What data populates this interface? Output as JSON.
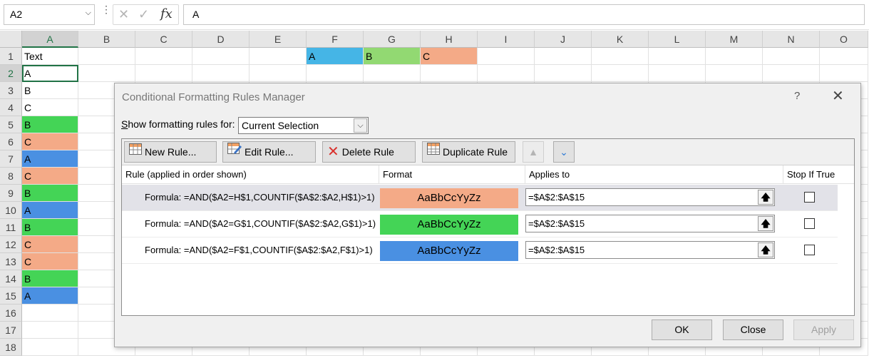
{
  "formula_bar": {
    "name_box": "A2",
    "formula": "A",
    "cancel_icon": "cancel-x-icon",
    "enter_icon": "checkmark-icon",
    "fx_label": "fx"
  },
  "sheet": {
    "columns": [
      "A",
      "B",
      "C",
      "D",
      "E",
      "F",
      "G",
      "H",
      "I",
      "J",
      "K",
      "L",
      "M",
      "N",
      "O"
    ],
    "rows": [
      "1",
      "2",
      "3",
      "4",
      "5",
      "6",
      "7",
      "8",
      "9",
      "10",
      "11",
      "12",
      "13",
      "14",
      "15",
      "16",
      "17",
      "18"
    ],
    "column_a": [
      "Text",
      "A",
      "B",
      "C",
      "B",
      "C",
      "A",
      "C",
      "B",
      "A",
      "B",
      "C",
      "C",
      "B",
      "A",
      "",
      "",
      ""
    ],
    "column_a_fill": [
      "none",
      "none",
      "none",
      "none",
      "green",
      "salmon",
      "blue",
      "salmon",
      "green",
      "blue",
      "green",
      "salmon",
      "salmon",
      "green",
      "blue",
      "none",
      "none",
      "none"
    ],
    "header_cells": {
      "F1": "A",
      "G1": "B",
      "H1": "C"
    },
    "colors": {
      "green": "#44d456",
      "salmon": "#f4aa87",
      "blue": "#4a90e2",
      "f1_fill": "#45b5e6",
      "g1_fill": "#92d972",
      "h1_fill": "#f4aa87"
    }
  },
  "dialog": {
    "title": "Conditional Formatting Rules Manager",
    "help": "?",
    "close": "✕",
    "show_label": "Show formatting rules for:",
    "show_value": "Current Selection",
    "toolbar": {
      "new_rule": "New Rule...",
      "edit_rule": "Edit Rule...",
      "delete_rule": "Delete Rule",
      "duplicate_rule": "Duplicate Rule"
    },
    "columns": {
      "rule": "Rule (applied in order shown)",
      "format": "Format",
      "applies": "Applies to",
      "stop": "Stop If True"
    },
    "rules": [
      {
        "text": "Formula: =AND($A2=H$1,COUNTIF($A$2:$A2,H$1)>1)",
        "preview": "AaBbCcYyZz",
        "color": "#f4aa87",
        "applies": "=$A$2:$A$15",
        "stop": false,
        "selected": true
      },
      {
        "text": "Formula: =AND($A2=G$1,COUNTIF($A$2:$A2,G$1)>1)",
        "preview": "AaBbCcYyZz",
        "color": "#44d456",
        "applies": "=$A$2:$A$15",
        "stop": false,
        "selected": false
      },
      {
        "text": "Formula: =AND($A2=F$1,COUNTIF($A$2:$A2,F$1)>1)",
        "preview": "AaBbCcYyZz",
        "color": "#4a90e2",
        "applies": "=$A$2:$A$15",
        "stop": false,
        "selected": false
      }
    ],
    "buttons": {
      "ok": "OK",
      "close": "Close",
      "apply": "Apply"
    }
  }
}
